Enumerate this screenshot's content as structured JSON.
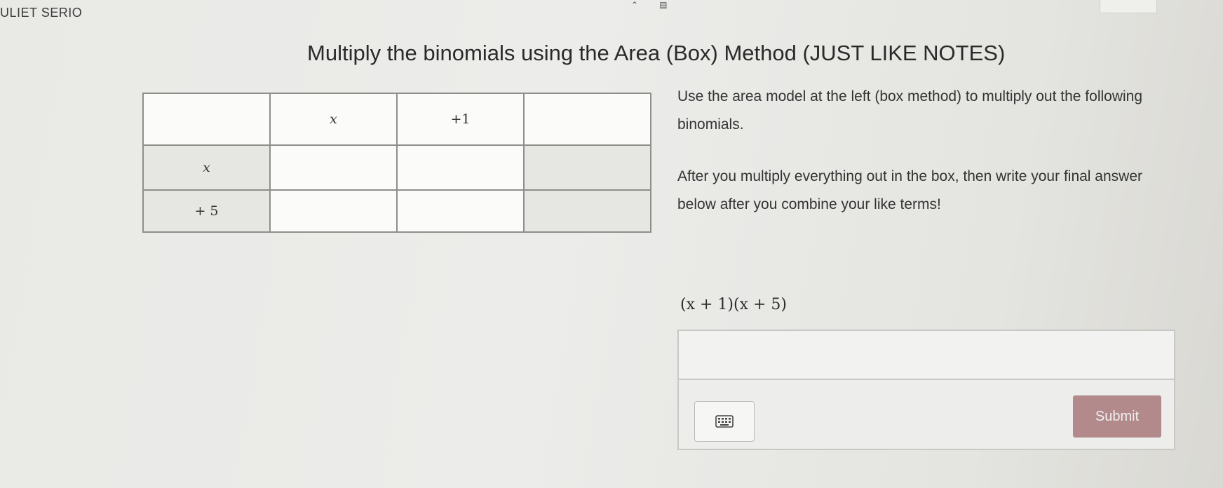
{
  "header": {
    "student_name": "ULIET SERIO"
  },
  "page_title": "Multiply the binomials using the Area (Box) Method (JUST LIKE NOTES)",
  "area_model": {
    "column_headers": [
      "",
      "x",
      "+1",
      ""
    ],
    "rows": [
      {
        "label": "x",
        "cells": [
          "",
          "",
          ""
        ]
      },
      {
        "label": "+ 5",
        "cells": [
          "",
          "",
          ""
        ]
      }
    ]
  },
  "instructions": {
    "line1": "Use the area model at the left (box method) to multiply out the following binomials.",
    "line2": "After you multiply everything out in the box, then write your final answer below after you combine your like terms!"
  },
  "problem": {
    "expression": "(x + 1)(x + 5)"
  },
  "answer": {
    "value": "",
    "placeholder": ""
  },
  "buttons": {
    "keypad_icon": "keyboard-icon",
    "submit_label": "Submit"
  },
  "colors": {
    "submit_button": "#b28a8c",
    "shaded_cell": "#e6e6e3"
  }
}
